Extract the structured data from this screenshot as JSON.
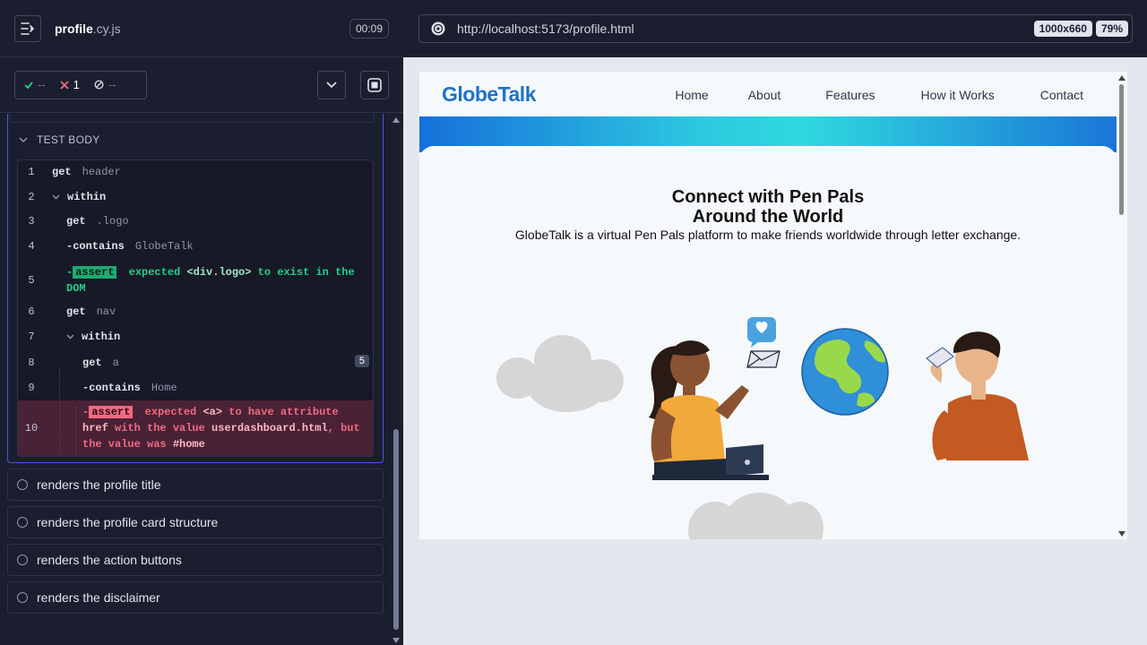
{
  "runner": {
    "spec": {
      "base": "profile",
      "ext": ".cy.js"
    },
    "timer": "00:09",
    "stats": {
      "passed": "--",
      "failed": "1",
      "pending": "--"
    },
    "test_body_label": "TEST BODY",
    "commands": [
      {
        "num": "1",
        "name": "get",
        "msg": "header"
      },
      {
        "num": "2",
        "name": "within",
        "msg": ""
      },
      {
        "num": "3",
        "name": "get",
        "msg": ".logo"
      },
      {
        "num": "4",
        "name": "contains",
        "msg": "GlobeTalk"
      },
      {
        "num": "5",
        "badge": "assert",
        "parts": [
          "expected",
          "<div.logo>",
          "to exist in the",
          "DOM"
        ]
      },
      {
        "num": "6",
        "name": "get",
        "msg": "nav"
      },
      {
        "num": "7",
        "name": "within",
        "msg": ""
      },
      {
        "num": "8",
        "name": "get",
        "msg": "a",
        "count": "5"
      },
      {
        "num": "9",
        "name": "contains",
        "msg": "Home"
      },
      {
        "num": "10",
        "badge": "assert",
        "parts": [
          "expected",
          "<a>",
          "to have attribute",
          "href",
          "with the value",
          "userdashboard.html",
          ", but",
          "the value was",
          "#home"
        ]
      }
    ],
    "tests": [
      "renders the profile title",
      "renders the profile card structure",
      "renders the action buttons",
      "renders the disclaimer"
    ]
  },
  "aut": {
    "url": "http://localhost:5173/profile.html",
    "viewport_size": "1000x660",
    "zoom": "79%"
  },
  "site": {
    "logo": "GlobeTalk",
    "nav": [
      "Home",
      "About",
      "Features",
      "How it Works",
      "Contact"
    ],
    "hero_title_1": "Connect with Pen Pals",
    "hero_title_2": "Around the World",
    "hero_sub": "GlobeTalk is a virtual Pen Pals platform to make friends worldwide through letter exchange."
  },
  "colors": {
    "brand": "#1e73c5",
    "pass": "#1fa971",
    "fail": "#f06a82",
    "runner_bg": "#1b1e2e",
    "accent": "#4956e3"
  }
}
